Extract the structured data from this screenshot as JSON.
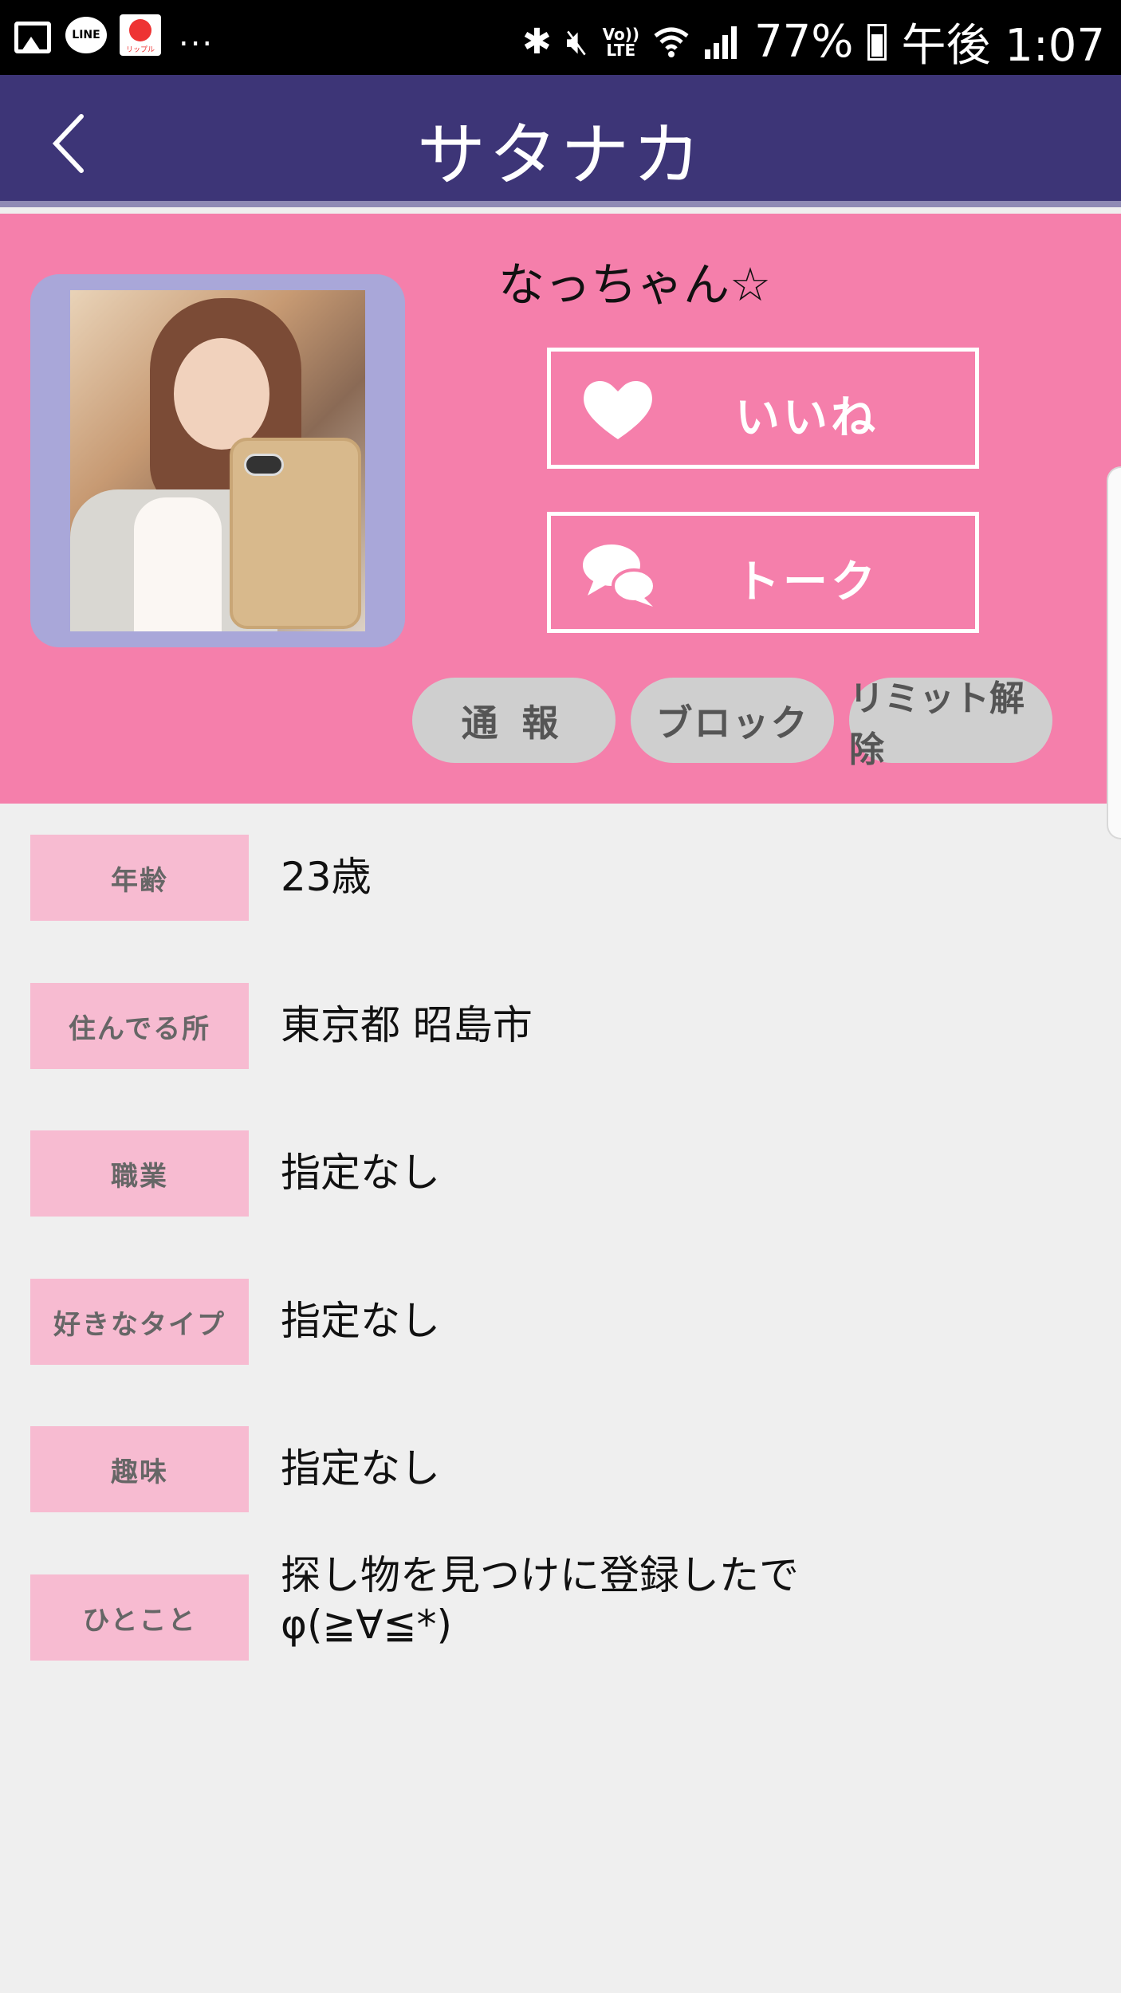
{
  "status_bar": {
    "line_app": "LINE",
    "app_icon_caption": "リップル",
    "more": "...",
    "volte": "Vo))",
    "lte": "LTE",
    "battery": "77%",
    "time": "午後 1:07"
  },
  "header": {
    "title": "サタナカ"
  },
  "profile": {
    "nickname": "なっちゃん☆",
    "like_label": "いいね",
    "talk_label": "トーク",
    "report_label": "通報",
    "block_label": "ブロック",
    "limit_label": "リミット解除"
  },
  "colors": {
    "titlebar": "#3d3577",
    "profile_bg": "#f57fab",
    "photo_frame": "#a9a7d9",
    "label_bg": "#f7bbd1",
    "pill_bg": "#cfcfcf"
  },
  "info": [
    {
      "label": "年齢",
      "value": "23歳"
    },
    {
      "label": "住んでる所",
      "value": "東京都 昭島市"
    },
    {
      "label": "職業",
      "value": "指定なし"
    },
    {
      "label": "好きなタイプ",
      "value": "指定なし"
    },
    {
      "label": "趣味",
      "value": "指定なし"
    },
    {
      "label": "ひとこと",
      "value_line1": "探し物を見つけに登録したで",
      "value_line2": "φ(≧∀≦*)"
    }
  ]
}
